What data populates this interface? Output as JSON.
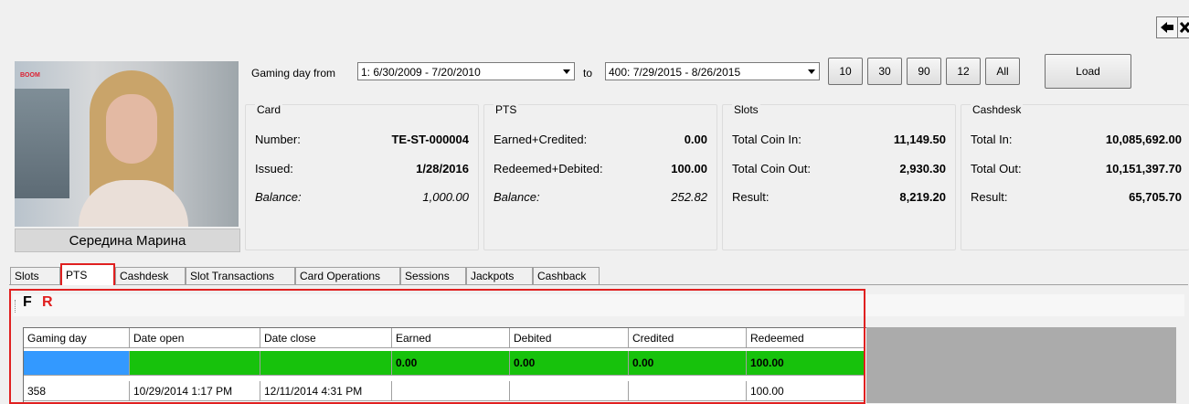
{
  "nav": {
    "back_icon": "arrow-left-icon",
    "close_icon": "close-icon"
  },
  "player": {
    "name": "Середина Марина",
    "photo_text": "BOOM"
  },
  "range": {
    "from_label": "Gaming day from",
    "from_value": "1: 6/30/2009 - 7/20/2010",
    "to_label": "to",
    "to_value": "400: 7/29/2015 - 8/26/2015",
    "quick_buttons": [
      "10",
      "30",
      "90",
      "12",
      "All"
    ],
    "load_label": "Load"
  },
  "card": {
    "title": "Card",
    "rows": [
      {
        "label": "Number:",
        "value": "TE-ST-000004"
      },
      {
        "label": "Issued:",
        "value": "1/28/2016"
      },
      {
        "label": "Balance:",
        "value": "1,000.00"
      }
    ]
  },
  "pts": {
    "title": "PTS",
    "rows": [
      {
        "label": "Earned+Credited:",
        "value": "0.00"
      },
      {
        "label": "Redeemed+Debited:",
        "value": "100.00"
      },
      {
        "label": "Balance:",
        "value": "252.82"
      }
    ]
  },
  "slots": {
    "title": "Slots",
    "rows": [
      {
        "label": "Total Coin In:",
        "value": "11,149.50"
      },
      {
        "label": "Total Coin Out:",
        "value": "2,930.30"
      },
      {
        "label": "Result:",
        "value": "8,219.20"
      }
    ]
  },
  "cashdesk": {
    "title": "Cashdesk",
    "rows": [
      {
        "label": "Total In:",
        "value": "10,085,692.00"
      },
      {
        "label": "Total Out:",
        "value": "10,151,397.70"
      },
      {
        "label": "Result:",
        "value": "65,705.70"
      }
    ]
  },
  "tabs": [
    "Slots",
    "PTS",
    "Cashdesk",
    "Slot Transactions",
    "Card Operations",
    "Sessions",
    "Jackpots",
    "Cashback"
  ],
  "toolbar": {
    "f_label": "F",
    "r_label": "R"
  },
  "table": {
    "columns": [
      "Gaming day",
      "Date open",
      "Date close",
      "Earned",
      "Debited",
      "Credited",
      "Redeemed"
    ],
    "total_row": [
      "",
      "",
      "",
      "0.00",
      "0.00",
      "0.00",
      "100.00"
    ],
    "rows": [
      [
        "358",
        "10/29/2014 1:17 PM",
        "12/11/2014 4:31 PM",
        "",
        "",
        "",
        "100.00"
      ]
    ]
  },
  "colors": {
    "accent_red": "#e02020",
    "total_green": "#17c20c",
    "selected_blue": "#3399ff"
  }
}
